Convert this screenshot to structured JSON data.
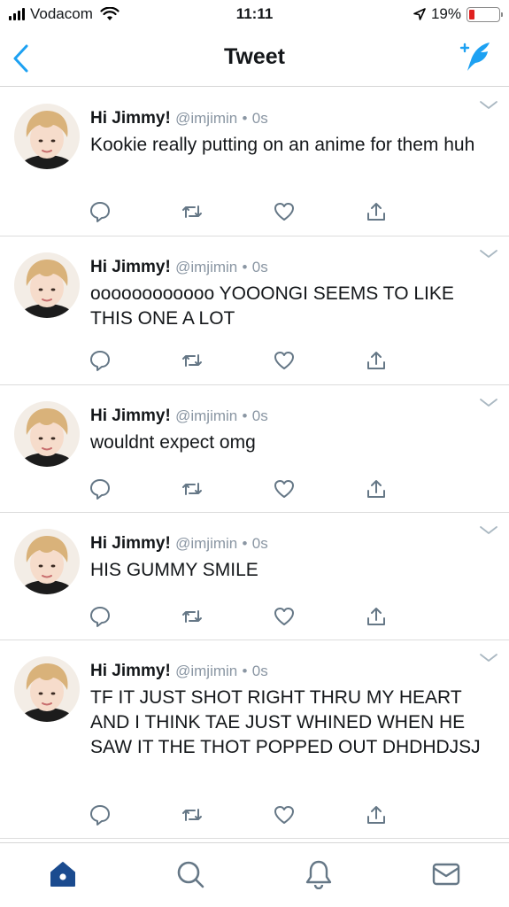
{
  "status_bar": {
    "carrier": "Vodacom",
    "time": "11:11",
    "battery_percent": "19%",
    "battery_level": 0.19
  },
  "nav": {
    "title": "Tweet"
  },
  "tweets": [
    {
      "name": "Hi Jimmy!",
      "handle": "@imjimin",
      "dot": "•",
      "time": "0s",
      "text": "Kookie really putting on an anime for them huh"
    },
    {
      "name": "Hi Jimmy!",
      "handle": "@imjimin",
      "dot": "•",
      "time": "0s",
      "text": "oooooooooooo YOOONGI SEEMS TO LIKE THIS ONE A LOT"
    },
    {
      "name": "Hi Jimmy!",
      "handle": "@imjimin",
      "dot": "•",
      "time": "0s",
      "text": "wouldnt expect omg"
    },
    {
      "name": "Hi Jimmy!",
      "handle": "@imjimin",
      "dot": "•",
      "time": "0s",
      "text": "HIS GUMMY SMILE"
    },
    {
      "name": "Hi Jimmy!",
      "handle": "@imjimin",
      "dot": "•",
      "time": "0s",
      "text": "TF IT JUST SHOT RIGHT THRU MY HEART AND I THINK TAE JUST WHINED WHEN HE SAW IT THE THOT POPPED OUT DHDHDJSJ"
    }
  ],
  "icons": {
    "back": "chevron-left-icon",
    "compose": "compose-tweet-icon",
    "reply": "reply-icon",
    "retweet": "retweet-icon",
    "like": "heart-icon",
    "share": "share-icon",
    "home": "home-icon",
    "search": "search-icon",
    "notifications": "bell-icon",
    "messages": "envelope-icon"
  },
  "colors": {
    "accent": "#1da1f2",
    "home_active": "#1b4b8f",
    "icon_gray": "#657786",
    "battery_low": "#e0201f"
  }
}
